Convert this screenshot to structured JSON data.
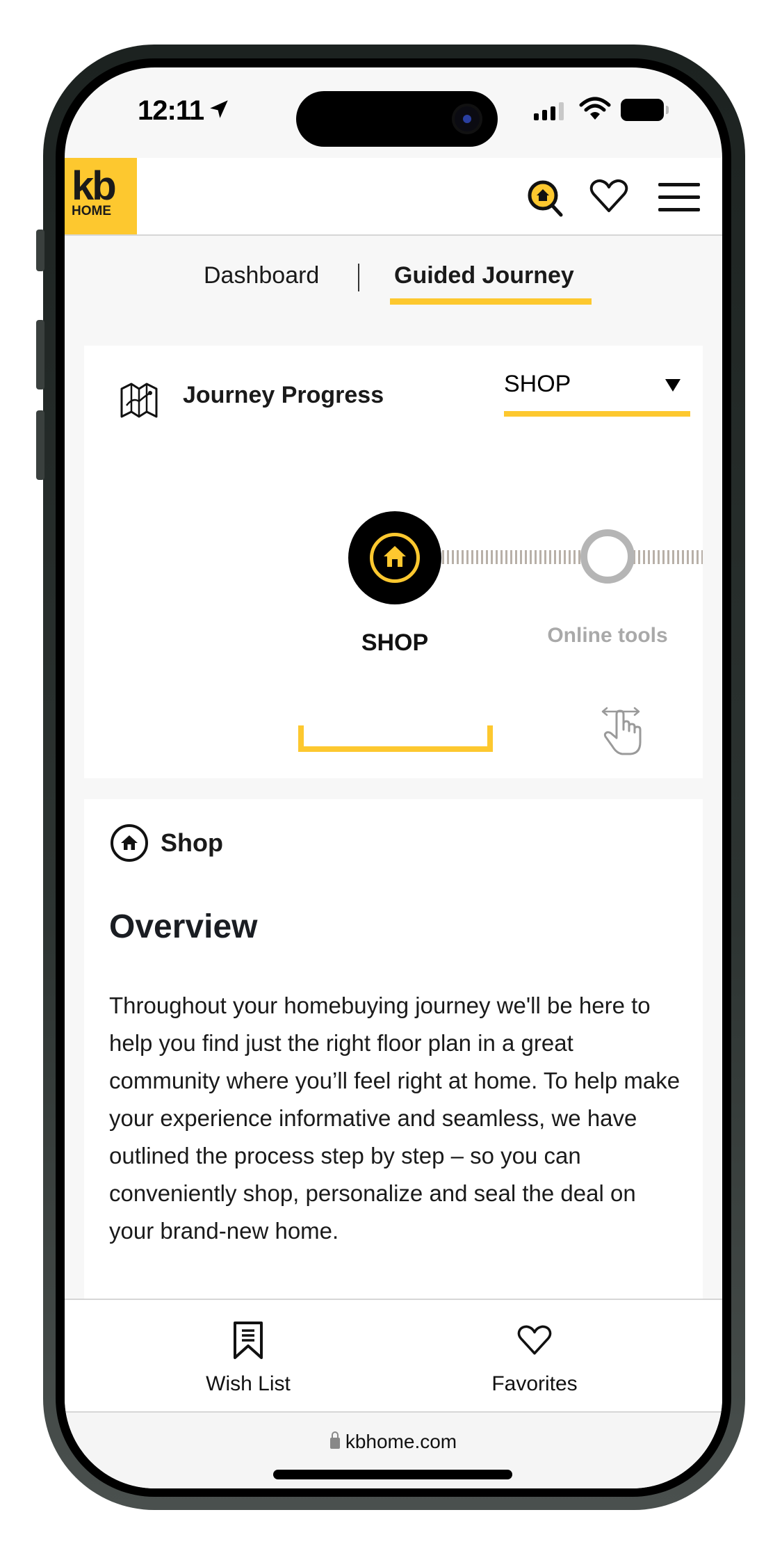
{
  "status_bar": {
    "time": "12:11",
    "location_icon": "location-arrow-icon",
    "signal_icon": "cellular-signal-icon",
    "wifi_icon": "wifi-icon",
    "battery_icon": "battery-icon"
  },
  "header": {
    "logo_text_top": "kb",
    "logo_text_bottom": "HOME",
    "icons": [
      "home-search-icon",
      "heart-icon",
      "hamburger-menu-icon"
    ],
    "brand_color": "#fdc82f"
  },
  "tabs": [
    {
      "label": "Dashboard",
      "active": false
    },
    {
      "label": "Guided Journey",
      "active": true
    }
  ],
  "journey_progress": {
    "title": "Journey Progress",
    "selected_stage": "SHOP",
    "steps": [
      {
        "label": "SHOP",
        "state": "current"
      },
      {
        "label": "Online tools",
        "state": "upcoming"
      }
    ]
  },
  "content": {
    "section_label": "Shop",
    "heading": "Overview",
    "body": "Throughout your homebuying journey we'll be here to help you find just the right floor plan in a great community where you’ll feel right at home. To help make your experience informative and seamless, we have outlined the process step by step – so you can conveniently shop, personalize and seal the deal on your brand-new home."
  },
  "bottom_nav": [
    {
      "label": "Wish List",
      "icon": "bookmark-list-icon"
    },
    {
      "label": "Favorites",
      "icon": "heart-icon"
    }
  ],
  "browser": {
    "url": "kbhome.com"
  }
}
